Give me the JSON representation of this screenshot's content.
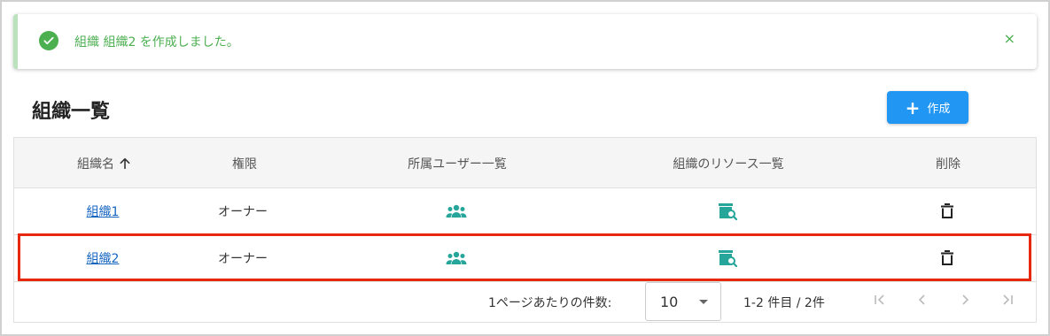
{
  "alert": {
    "message": "組織 組織2 を作成しました。",
    "close_label": "×",
    "color": "#4caf50"
  },
  "page": {
    "title": "組織一覧",
    "create_label": "作成",
    "accent": "#2196f3"
  },
  "table": {
    "headers": [
      "組織名",
      "権限",
      "所属ユーザー一覧",
      "組織のリソース一覧",
      "削除"
    ],
    "sort_icon": "arrow-up-icon",
    "rows": [
      {
        "name": "組織1",
        "role": "オーナー",
        "users_icon": "group-icon",
        "resources_icon": "resource-search-icon",
        "delete_icon": "trash-icon"
      },
      {
        "name": "組織2",
        "role": "オーナー",
        "users_icon": "group-icon",
        "resources_icon": "resource-search-icon",
        "delete_icon": "trash-icon"
      }
    ]
  },
  "pagination": {
    "rows_per_page_label": "1ページあたりの件数:",
    "rows_per_page_value": "10",
    "range_label": "1-2 件目 / 2件"
  },
  "highlight_color": "#e8270f"
}
